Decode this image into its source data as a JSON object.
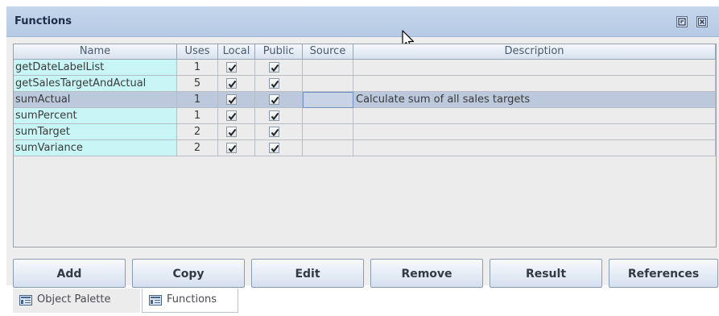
{
  "panel": {
    "title": "Functions",
    "controls": [
      "restore-icon",
      "close-icon"
    ]
  },
  "table": {
    "columns": [
      "Name",
      "Uses",
      "Local",
      "Public",
      "Source",
      "Description"
    ],
    "rows": [
      {
        "name": "getDateLabelList",
        "uses": "1",
        "local": true,
        "public": true,
        "source": "",
        "description": "",
        "selected": false
      },
      {
        "name": "getSalesTargetAndActual",
        "uses": "5",
        "local": true,
        "public": true,
        "source": "",
        "description": "",
        "selected": false
      },
      {
        "name": "sumActual",
        "uses": "1",
        "local": true,
        "public": true,
        "source": "",
        "description": "Calculate sum of all sales targets",
        "selected": true
      },
      {
        "name": "sumPercent",
        "uses": "1",
        "local": true,
        "public": true,
        "source": "",
        "description": "",
        "selected": false
      },
      {
        "name": "sumTarget",
        "uses": "2",
        "local": true,
        "public": true,
        "source": "",
        "description": "",
        "selected": false
      },
      {
        "name": "sumVariance",
        "uses": "2",
        "local": true,
        "public": true,
        "source": "",
        "description": "",
        "selected": false
      }
    ]
  },
  "buttons": {
    "add": "Add",
    "copy": "Copy",
    "edit": "Edit",
    "remove": "Remove",
    "result": "Result",
    "references": "References"
  },
  "tabs": [
    {
      "label": "Object Palette",
      "active": false
    },
    {
      "label": "Functions",
      "active": true
    }
  ],
  "colors": {
    "name_cell": "#c8f5f5",
    "selected_row": "#bcc9dd",
    "titlebar": "#b6cae4"
  }
}
